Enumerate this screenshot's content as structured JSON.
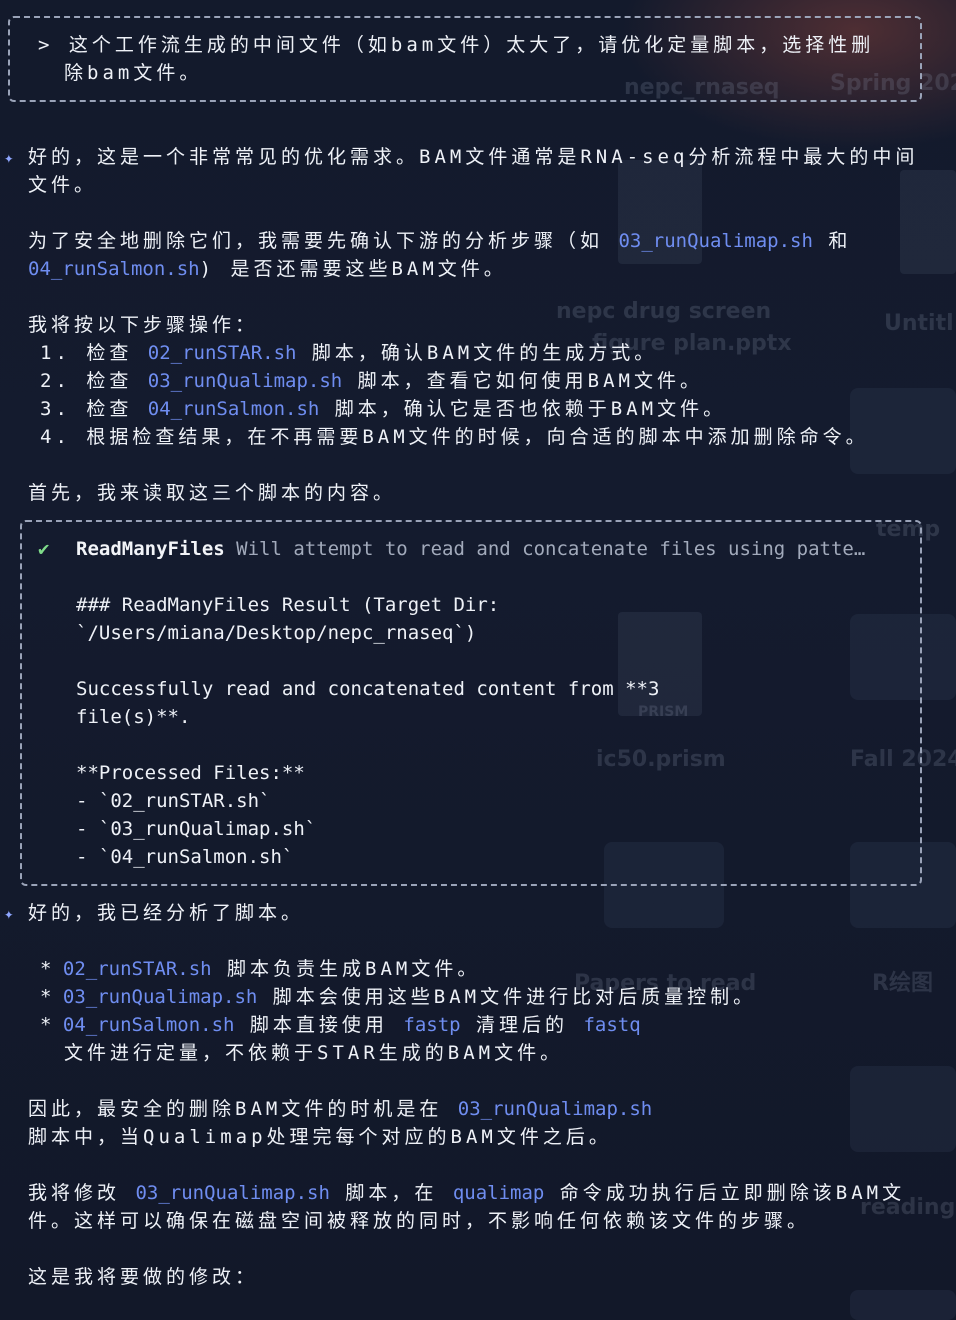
{
  "background": {
    "labels": [
      "nepc_rnaseq",
      "Spring 202",
      "nepc drug screen",
      "figure plan.pptx",
      "Untitl",
      "temp",
      "PRISM",
      "ic50.prism",
      "Fall 2024",
      "Papers to read",
      "R绘图",
      "reading"
    ]
  },
  "user_prompt": {
    "line1": "> 这个工作流生成的中间文件（如bam文件）太大了，请优化定量脚本，选择性删",
    "line2": "除bam文件。"
  },
  "response1": {
    "intro_line1": "好的，这是一个非常常见的优化需求。BAM文件通常是RNA-seq分析流程中最大的中间",
    "intro_line2": "文件。",
    "safety_line1_a": "为了安全地删除它们，我需要先确认下游的分析步骤（如 ",
    "safety_line1_code": "03_runQualimap.sh",
    "safety_line1_b": " 和",
    "safety_line2_code": "04_runSalmon.sh",
    "safety_line2_b": ") 是否还需要这些BAM文件。",
    "steps_heading": "我将按以下步骤操作：",
    "steps": [
      {
        "num": "1. 检查 ",
        "code": "02_runSTAR.sh",
        "text": " 脚本，确认BAM文件的生成方式。"
      },
      {
        "num": "2. 检查 ",
        "code": "03_runQualimap.sh",
        "text": " 脚本，查看它如何使用BAM文件。"
      },
      {
        "num": "3. 检查 ",
        "code": "04_runSalmon.sh",
        "text": " 脚本，确认它是否也依赖于BAM文件。"
      },
      {
        "num": "4. ",
        "code": "",
        "text": "根据检查结果，在不再需要BAM文件的时候，向合适的脚本中添加删除命令。"
      }
    ],
    "read_line": "首先，我来读取这三个脚本的内容。"
  },
  "tool_call": {
    "status_icon": "✔",
    "name": "ReadManyFiles",
    "description": " Will attempt to read and concatenate files using patte…",
    "result_line1": "### ReadManyFiles Result (Target Dir:",
    "result_line2": "`/Users/miana/Desktop/nepc_rnaseq`)",
    "success_line1": "Successfully read and concatenated content from **3",
    "success_line2": "file(s)**.",
    "processed_heading": "**Processed Files:**",
    "files": [
      "- `02_runSTAR.sh`",
      "- `03_runQualimap.sh`",
      "- `04_runSalmon.sh`"
    ]
  },
  "response2": {
    "intro": "好的，我已经分析了脚本。",
    "bullets": [
      {
        "code": "02_runSTAR.sh",
        "text": " 脚本负责生成BAM文件。"
      },
      {
        "code": "03_runQualimap.sh",
        "text": " 脚本会使用这些BAM文件进行比对后质量控制。"
      },
      {
        "code": "04_runSalmon.sh",
        "text": " 脚本直接使用 ",
        "code2": "fastp",
        "text2": " 清理后的 ",
        "code3": "fastq"
      }
    ],
    "bullet3_cont": "文件进行定量，不依赖于STAR生成的BAM文件。",
    "therefore_line1_a": "因此，最安全的删除BAM文件的时机是在 ",
    "therefore_line1_code": "03_runQualimap.sh",
    "therefore_line2": "脚本中，当Qualimap处理完每个对应的BAM文件之后。",
    "modify_line1_a": "我将修改 ",
    "modify_line1_code": "03_runQualimap.sh",
    "modify_line1_b": " 脚本，在 ",
    "modify_line1_code2": "qualimap",
    "modify_line1_c": " 命令成功执行后立即删除该BAM文",
    "modify_line2": "件。这样可以确保在磁盘空间被释放的同时，不影响任何依赖该文件的步骤。",
    "final_line": "这是我将要做的修改："
  },
  "colors": {
    "background": "#141b2e",
    "text": "#eef1f7",
    "code": "#6f8df0",
    "sparkle": "#8ea6ff",
    "check": "#7fdb8a",
    "border": "#9aa3b8"
  }
}
